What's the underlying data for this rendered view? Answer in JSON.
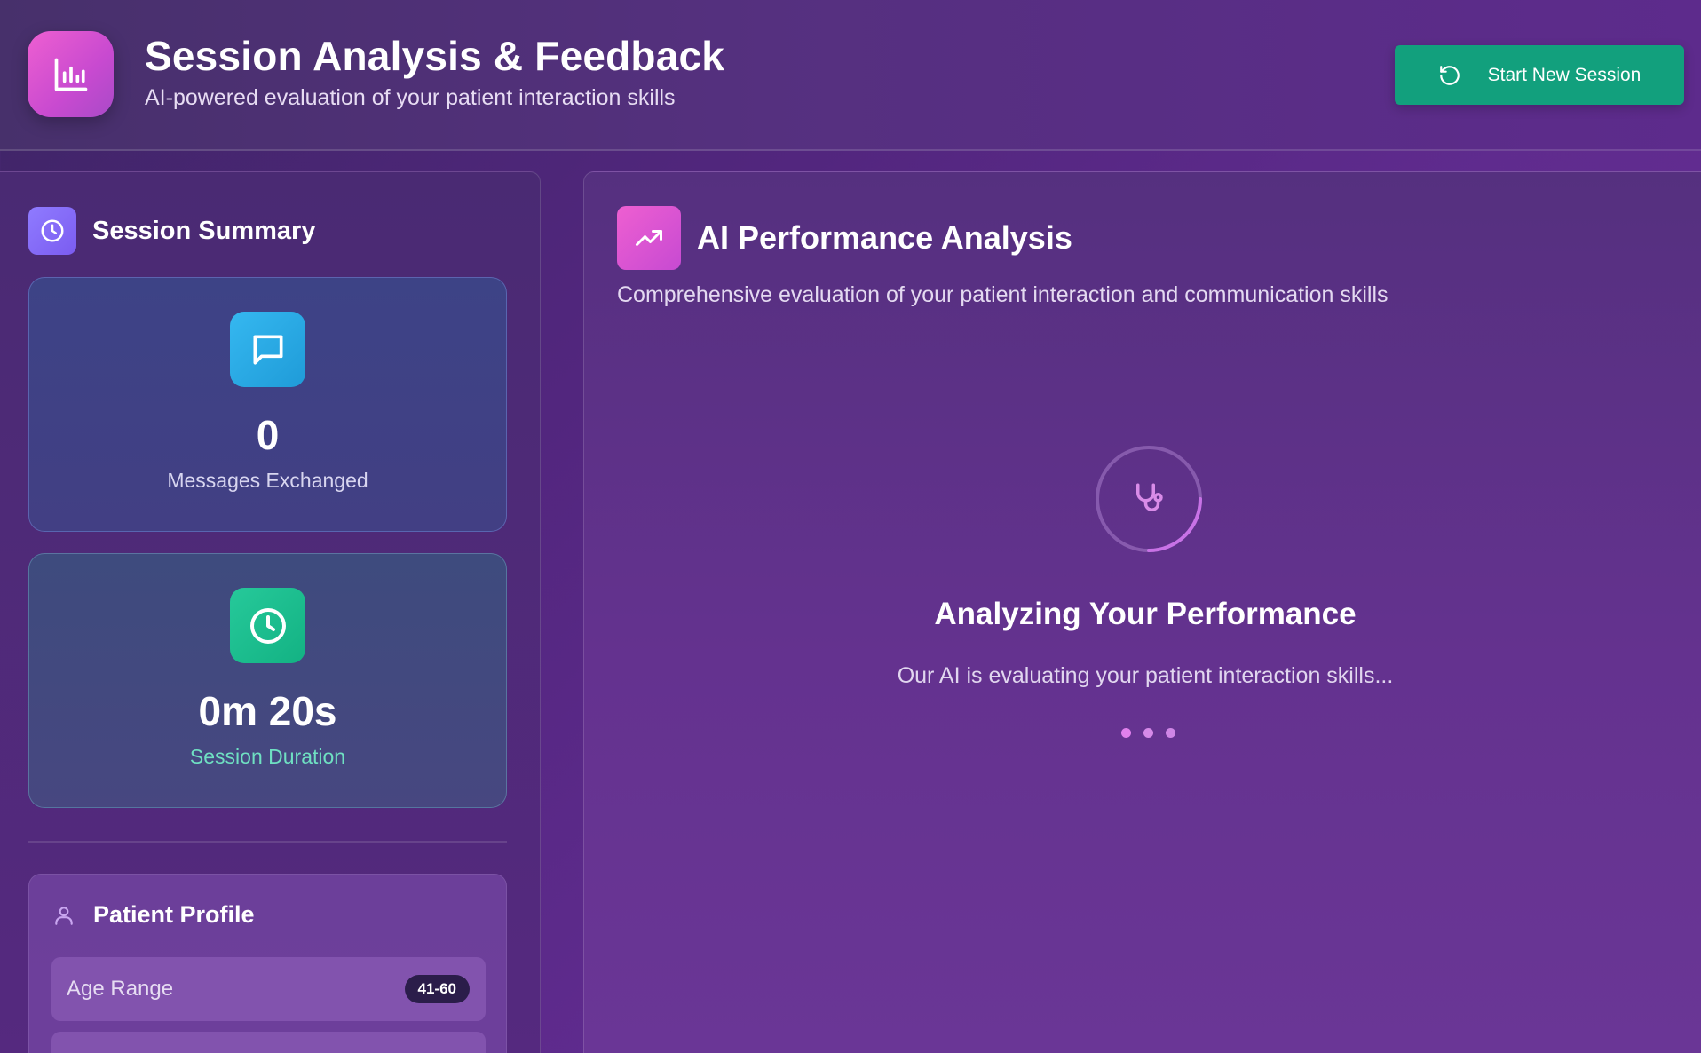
{
  "header": {
    "title": "Session Analysis & Feedback",
    "subtitle": "AI-powered evaluation of your patient interaction skills",
    "logo_icon": "bar-chart-icon",
    "new_session_label": "Start New Session",
    "new_session_icon": "refresh-icon"
  },
  "sidebar": {
    "summary_title": "Session Summary",
    "summary_icon": "clock-icon",
    "messages": {
      "value": "0",
      "label": "Messages Exchanged",
      "icon": "chat-bubble-icon"
    },
    "duration": {
      "value": "0m 20s",
      "label": "Session Duration",
      "icon": "clock-icon"
    },
    "profile": {
      "title": "Patient Profile",
      "icon": "user-icon",
      "rows": [
        {
          "label": "Age Range",
          "value": "41-60"
        }
      ]
    }
  },
  "main": {
    "title": "AI Performance Analysis",
    "icon": "trending-up-icon",
    "subtitle": "Comprehensive evaluation of your patient interaction and communication skills",
    "loading_icon": "stethoscope-icon",
    "loading_title": "Analyzing Your Performance",
    "loading_text": "Our AI is evaluating your patient interaction skills..."
  },
  "colors": {
    "accent_green": "#12a07d",
    "accent_pink": "#ee5fd1",
    "accent_blue": "#35b8f0",
    "accent_violet": "#8f7bff"
  }
}
